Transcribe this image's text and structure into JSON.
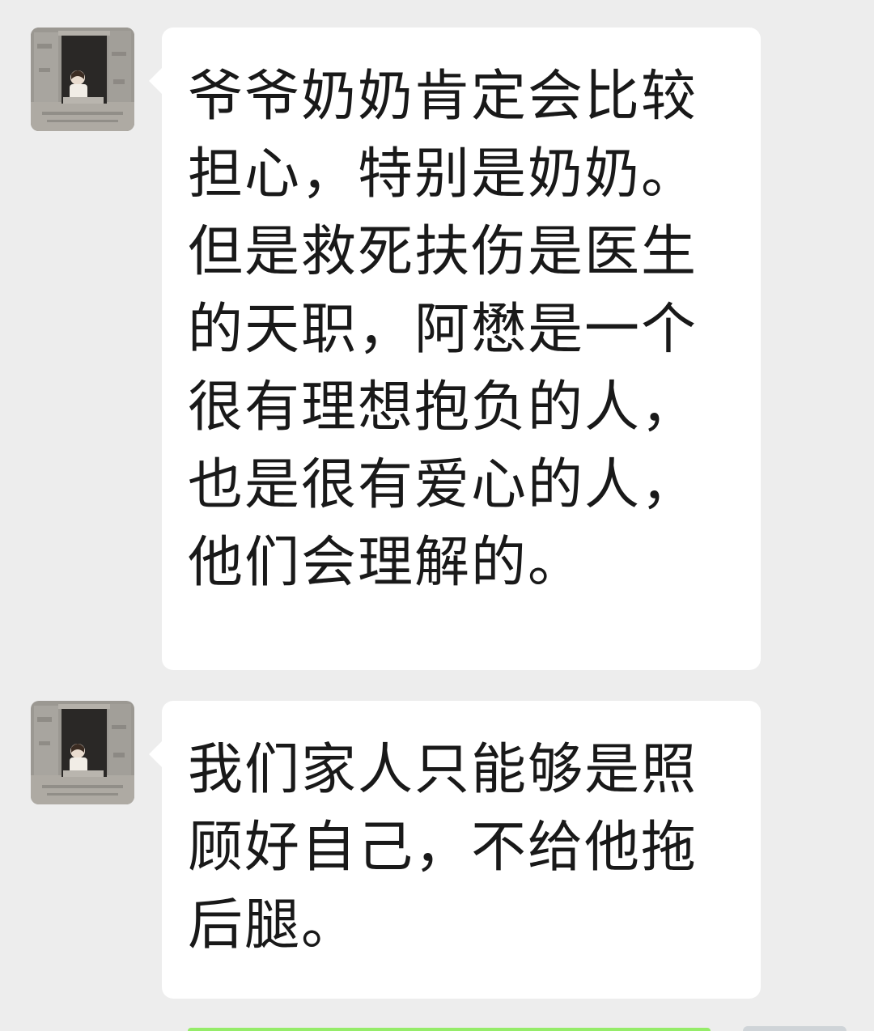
{
  "messages": [
    {
      "sender": "contact",
      "avatar_icon": "window-portrait-avatar-icon",
      "text": "爷爷奶奶肯定会比较担心，特别是奶奶。但是救死扶伤是医生的天职，阿懋是一个很有理想抱负的人，也是很有爱心的人，他们会理解的。"
    },
    {
      "sender": "contact",
      "avatar_icon": "window-portrait-avatar-icon",
      "text": "我们家人只能够是照顾好自己，不给他拖后腿。"
    }
  ],
  "colors": {
    "background": "#ededed",
    "bubble": "#ffffff",
    "text": "#191919",
    "self_bubble": "#95ec69"
  }
}
